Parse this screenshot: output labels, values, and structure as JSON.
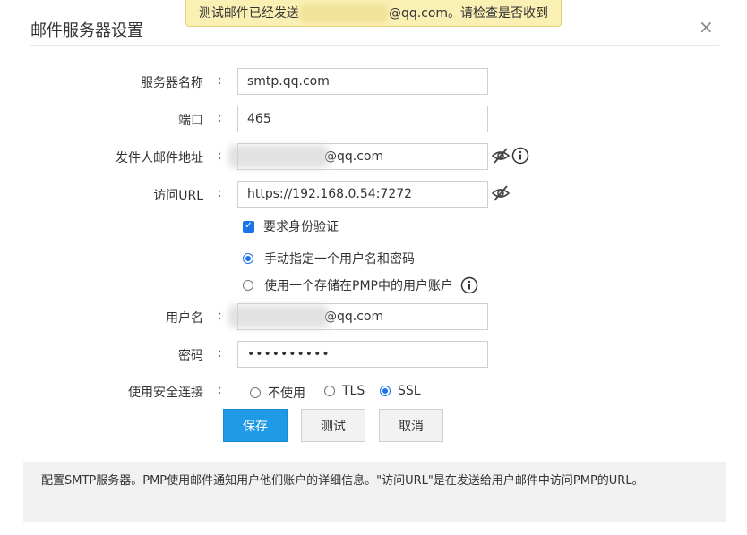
{
  "toast": {
    "prefix": "测试邮件已经发送",
    "suffix": "@qq.com。请检查是否收到"
  },
  "dialog": {
    "title": "邮件服务器设置",
    "close_glyph": "×"
  },
  "form": {
    "colon": ":",
    "server": {
      "label": "服务器名称",
      "value": "smtp.qq.com"
    },
    "port": {
      "label": "端口",
      "value": "465"
    },
    "sender": {
      "label": "发件人邮件地址",
      "value": "@qq.com"
    },
    "access_url": {
      "label": "访问URL",
      "value": "https://192.168.0.54:7272"
    },
    "require_auth": {
      "label": "要求身份验证",
      "checked": true
    },
    "auth_options": [
      {
        "label": "手动指定一个用户名和密码",
        "selected": true
      },
      {
        "label": "使用一个存储在PMP中的用户账户",
        "selected": false
      }
    ],
    "username": {
      "label": "用户名",
      "value": "@qq.com"
    },
    "password": {
      "label": "密码",
      "value": "••••••••••"
    },
    "secure": {
      "label": "使用安全连接",
      "options": [
        {
          "label": "不使用",
          "selected": false
        },
        {
          "label": "TLS",
          "selected": false
        },
        {
          "label": "SSL",
          "selected": true
        }
      ]
    }
  },
  "buttons": {
    "save": "保存",
    "test": "测试",
    "cancel": "取消"
  },
  "note": "配置SMTP服务器。PMP使用邮件通知用户他们账户的详细信息。\"访问URL\"是在发送给用户邮件中访问PMP的URL。",
  "colors": {
    "primary": "#1f9ae6",
    "toast_bg": "#fbf0b4",
    "accent": "#1a73e8"
  }
}
